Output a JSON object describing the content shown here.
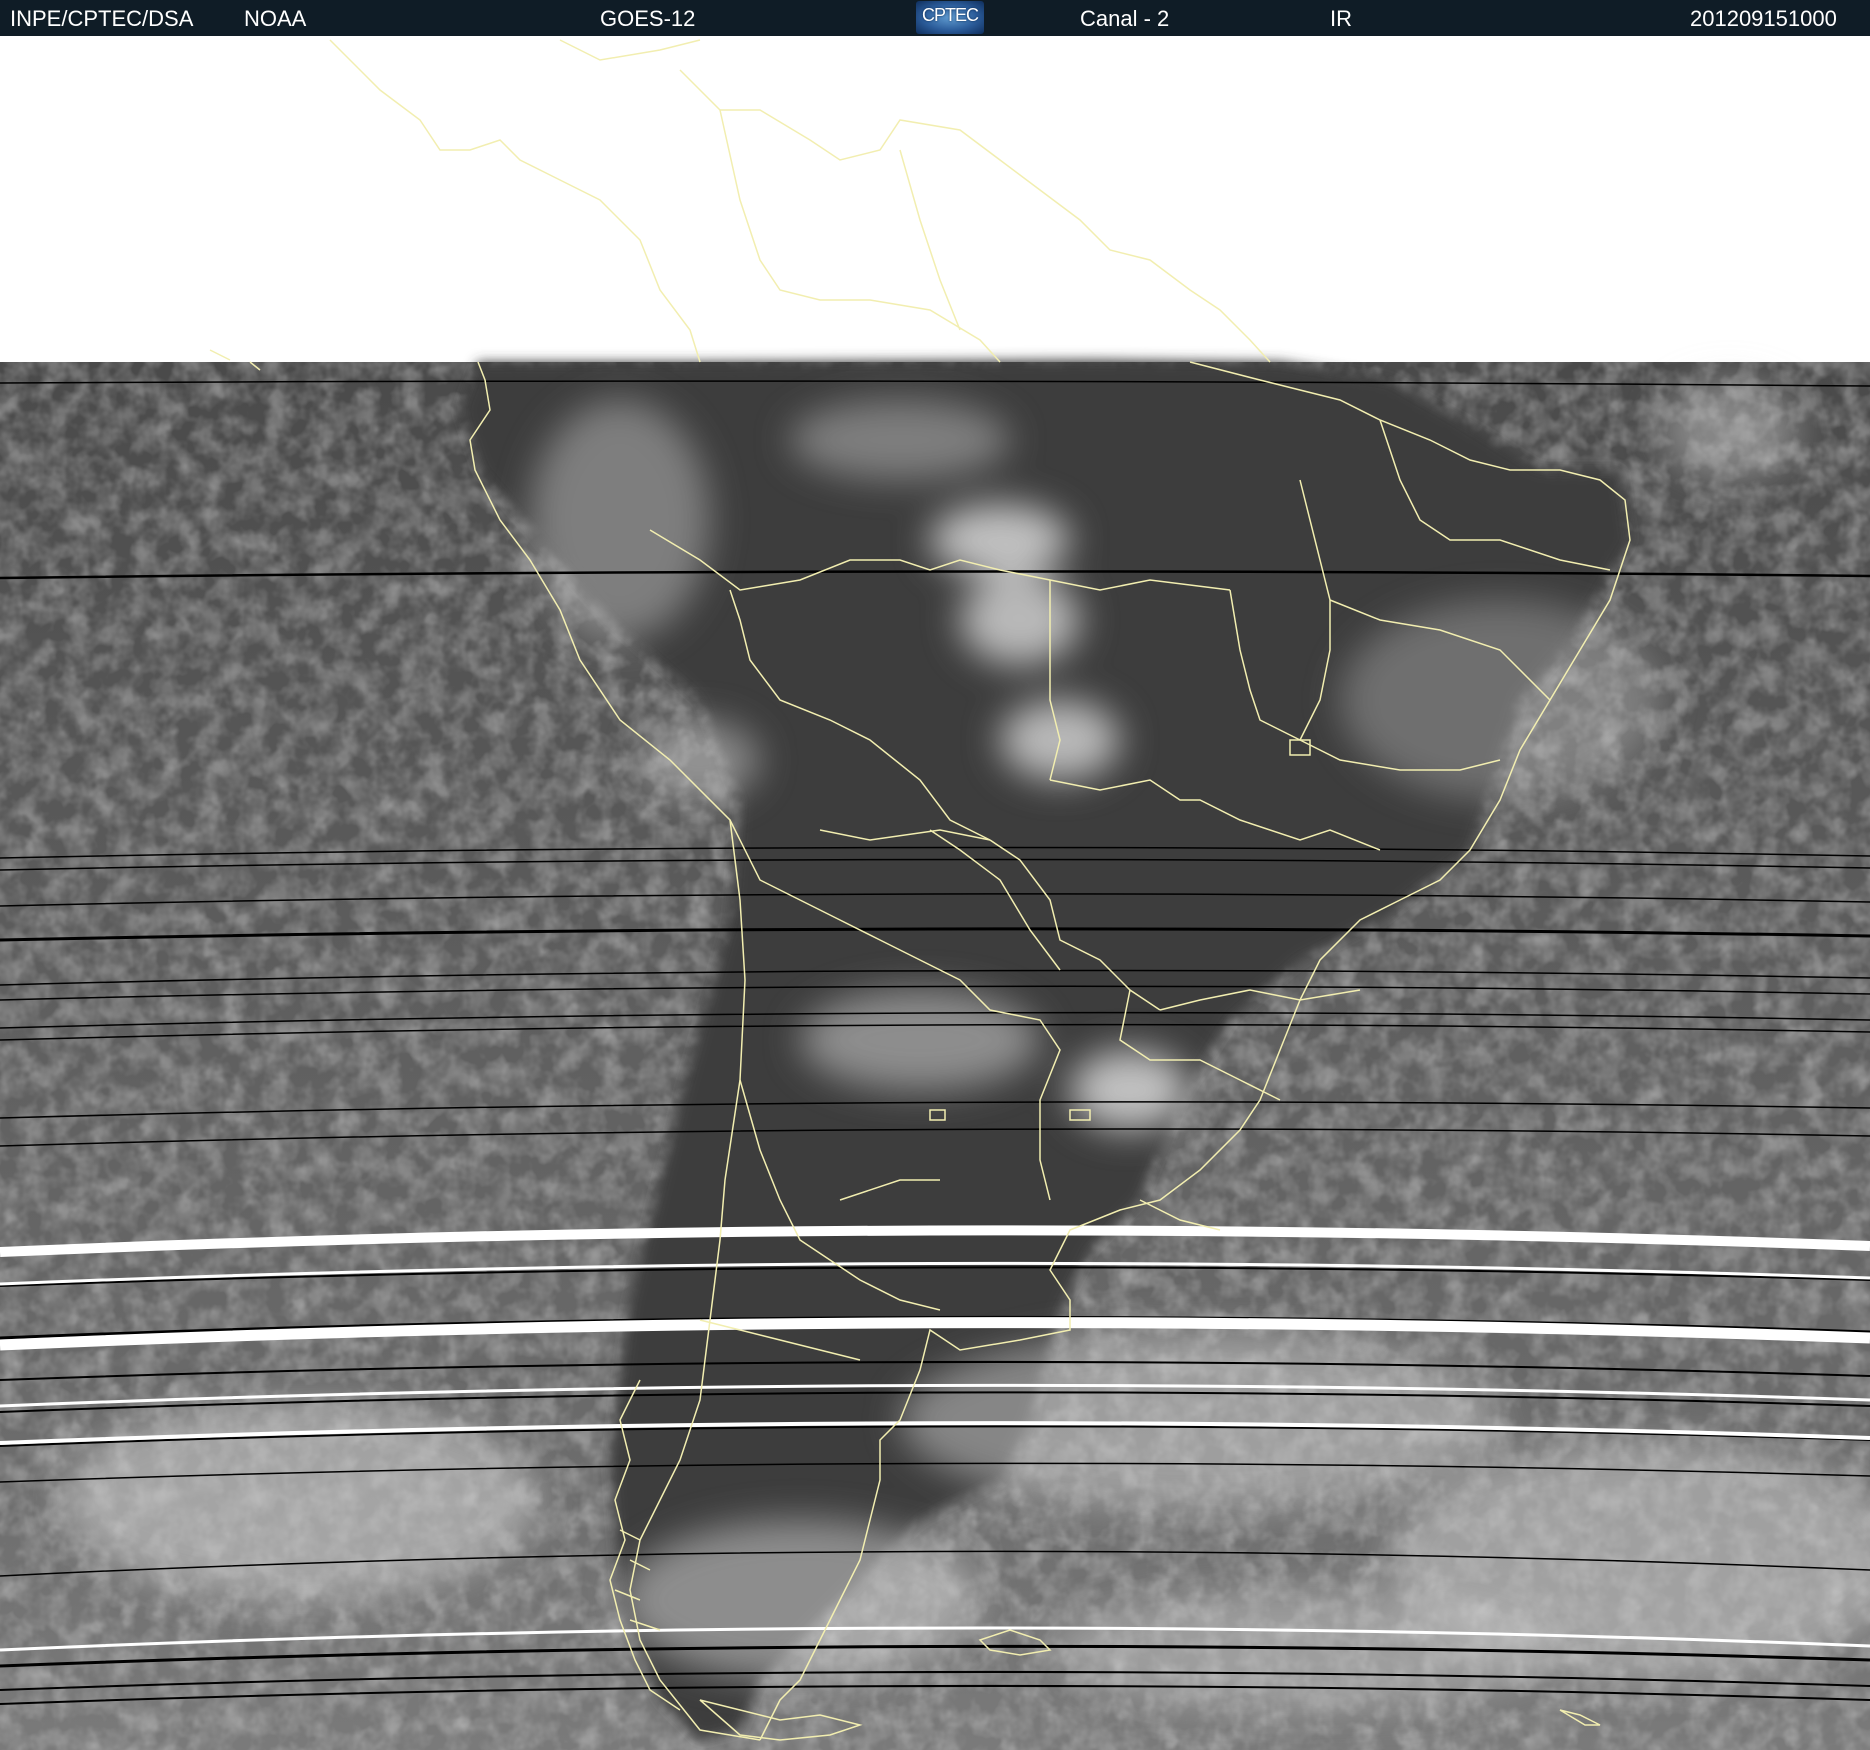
{
  "header": {
    "institution": "INPE/CPTEC/DSA",
    "agency": "NOAA",
    "satellite": "GOES-12",
    "logo_text": "CPTEC",
    "channel": "Canal - 2",
    "band": "IR",
    "timestamp": "201209151000"
  },
  "colors": {
    "header_bg": "#0f1c26",
    "header_text": "#ffffff",
    "coastline": "#f2eeb0",
    "no_data": "#ffffff",
    "scanline": "#000000",
    "ocean_ir": "#5a5a5a",
    "land_ir": "#3a3a3a",
    "cloud_ir": "#d8d8d8"
  },
  "icons": {
    "logo": "cptec-logo"
  }
}
